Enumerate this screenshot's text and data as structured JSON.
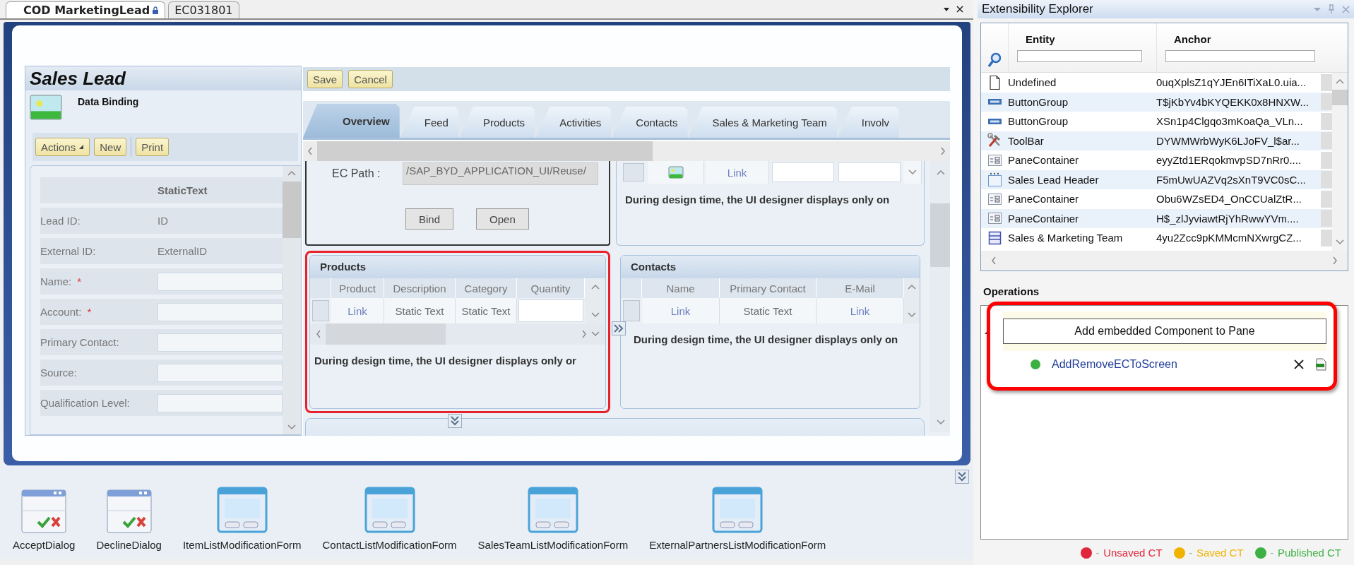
{
  "document_tabs": [
    {
      "label": "COD MarketingLead",
      "selected": true,
      "locked": true
    },
    {
      "label": "EC031801",
      "selected": false,
      "locked": false
    }
  ],
  "designer": {
    "header": {
      "title": "Sales Lead",
      "subtitle": "Data Binding"
    },
    "header_buttons": [
      {
        "label": "Actions",
        "menu": true,
        "group_start": false
      },
      {
        "label": "New",
        "menu": false,
        "group_start": false
      },
      {
        "label": "Print",
        "menu": false,
        "group_start": true
      }
    ],
    "form": {
      "column_heading": "StaticText",
      "fields": [
        {
          "label": "Lead ID:",
          "kind": "text",
          "value": "ID"
        },
        {
          "label": "External ID:",
          "kind": "text",
          "value": "ExternalID"
        },
        {
          "label": "Name:",
          "kind": "input",
          "required_mark": "*"
        },
        {
          "label": "Account:",
          "kind": "input",
          "required_mark": "*"
        },
        {
          "label": "Primary Contact:",
          "kind": "input"
        },
        {
          "label": "Source:",
          "kind": "input"
        },
        {
          "label": "Qualification Level:",
          "kind": "input"
        }
      ]
    },
    "toolbar_buttons": [
      "Save",
      "Cancel"
    ],
    "tabs": [
      {
        "label": "Overview",
        "selected": true
      },
      {
        "label": "Feed",
        "selected": false
      },
      {
        "label": "Products",
        "selected": false
      },
      {
        "label": "Activities",
        "selected": false
      },
      {
        "label": "Contacts",
        "selected": false
      },
      {
        "label": "Sales & Marketing Team",
        "selected": false
      },
      {
        "label": "Involv",
        "selected": false
      }
    ],
    "ec_pane": {
      "label": "EC Path :",
      "path": "/SAP_BYD_APPLICATION_UI/Reuse/",
      "buttons": [
        "Bind",
        "Open"
      ]
    },
    "upper_pane": {
      "cells": [
        {
          "kind": "image"
        },
        {
          "kind": "link",
          "text": "Link"
        },
        {
          "kind": "input"
        },
        {
          "kind": "input"
        }
      ],
      "note": "During design time, the UI designer displays only on"
    },
    "products_pane": {
      "title": "Products",
      "highlighted": true,
      "columns": [
        "Product",
        "Description",
        "Category",
        "Quantity"
      ],
      "cells": [
        {
          "kind": "link",
          "text": "Link"
        },
        {
          "kind": "text",
          "text": "Static Text"
        },
        {
          "kind": "text",
          "text": "Static Text"
        },
        {
          "kind": "input"
        }
      ],
      "note": "During design time, the UI designer displays only or"
    },
    "contacts_pane": {
      "title": "Contacts",
      "highlighted": false,
      "columns": [
        "Name",
        "Primary Contact",
        "E-Mail"
      ],
      "cells": [
        {
          "kind": "link",
          "text": "Link"
        },
        {
          "kind": "text",
          "text": "Static Text"
        },
        {
          "kind": "link",
          "text": "Link"
        }
      ],
      "note": "During design time, the UI designer displays only on"
    }
  },
  "components": [
    {
      "label": "AcceptDialog",
      "kind": "dialog"
    },
    {
      "label": "DeclineDialog",
      "kind": "dialog"
    },
    {
      "label": "ItemListModificationForm",
      "kind": "form"
    },
    {
      "label": "ContactListModificationForm",
      "kind": "form"
    },
    {
      "label": "SalesTeamListModificationForm",
      "kind": "form"
    },
    {
      "label": "ExternalPartnersListModificationForm",
      "kind": "form"
    }
  ],
  "explorer": {
    "title": "Extensibility Explorer",
    "columns": [
      "Entity",
      "Anchor"
    ],
    "rows": [
      {
        "kind": "document",
        "entity": "Undefined",
        "anchor": "0uqXplsZ1qYJEn6ITiXaL0.uia..."
      },
      {
        "kind": "buttongroup",
        "entity": "ButtonGroup",
        "anchor": "T$jKbYv4bKYQEKK0x8HNXW..."
      },
      {
        "kind": "buttongroup",
        "entity": "ButtonGroup",
        "anchor": "XSn1p4Clgqo3mKoaQa_VLn..."
      },
      {
        "kind": "toolbar",
        "entity": "ToolBar",
        "anchor": "DYWMWrbWyK6LJoFV_l$ar..."
      },
      {
        "kind": "panecontainer",
        "entity": "PaneContainer",
        "anchor": "eyyZtd1ERqokmvpSD7nRr0...."
      },
      {
        "kind": "header",
        "entity": "Sales Lead Header",
        "anchor": "F5mUwUAZVq2sXnT9VC0sC..."
      },
      {
        "kind": "panecontainer",
        "entity": "PaneContainer",
        "anchor": "Obu6WZsED4_OnCCUalZtR..."
      },
      {
        "kind": "panecontainer",
        "entity": "PaneContainer",
        "anchor": "H$_zlJyviawtRjYhRwwYVm...."
      },
      {
        "kind": "list",
        "entity": "Sales & Marketing Team",
        "anchor": "4yu2Zcc9pKMMcmNXwrgCZ..."
      }
    ]
  },
  "operations": {
    "title": "Operations",
    "highlighted": true,
    "group": {
      "label": "Add embedded Component to Pane",
      "expanded": true,
      "items": [
        {
          "label": "AddRemoveECToScreen",
          "color": "#3cb043"
        }
      ]
    }
  },
  "legend": [
    {
      "dash": "-",
      "label": "Unsaved CT",
      "color": "#e0263a"
    },
    {
      "dash": "-",
      "label": "Saved CT",
      "color": "#f0b400"
    },
    {
      "dash": "-",
      "label": "Published CT",
      "color": "#3cb043"
    }
  ]
}
